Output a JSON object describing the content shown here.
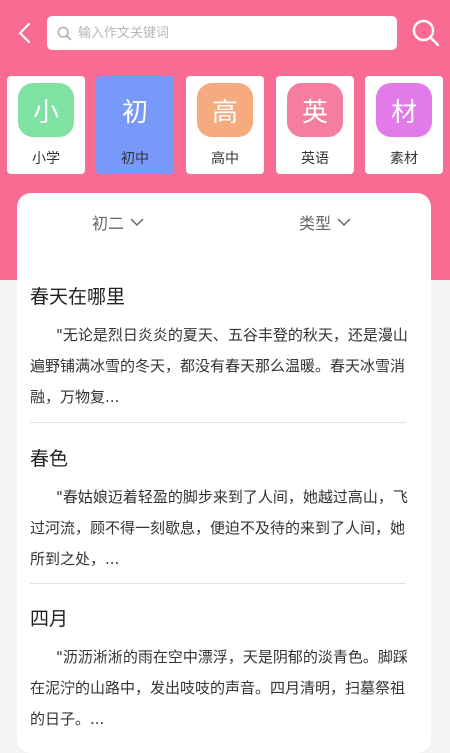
{
  "header": {
    "search_placeholder": "输入作文关键词"
  },
  "categories": [
    {
      "icon_char": "小",
      "label": "小学",
      "color": "#7fe2a3",
      "active": false
    },
    {
      "icon_char": "初",
      "label": "初中",
      "color": "#7899f9",
      "active": true
    },
    {
      "icon_char": "高",
      "label": "高中",
      "color": "#f6ab7e",
      "active": false
    },
    {
      "icon_char": "英",
      "label": "英语",
      "color": "#f57d9f",
      "active": false
    },
    {
      "icon_char": "材",
      "label": "素材",
      "color": "#e27ae9",
      "active": false
    }
  ],
  "filters": {
    "grade": "初二",
    "type": "类型"
  },
  "articles": [
    {
      "title": "春天在哪里",
      "excerpt": "\"无论是烈日炎炎的夏天、五谷丰登的秋天，还是漫山遍野铺满冰雪的冬天，都没有春天那么温暖。春天冰雪消融，万物复..."
    },
    {
      "title": "春色",
      "excerpt": "\"春姑娘迈着轻盈的脚步来到了人间，她越过高山，飞过河流，顾不得一刻歇息，便迫不及待的来到了人间，她所到之处，..."
    },
    {
      "title": "四月",
      "excerpt": "\"沥沥淅淅的雨在空中漂浮，天是阴郁的淡青色。脚踩在泥泞的山路中，发出吱吱的声音。四月清明，扫墓祭祖的日子。..."
    }
  ],
  "colors": {
    "header_bg": "#f86c94",
    "active_card": "#7899f9"
  },
  "icons": [
    "back-arrow-icon",
    "search-icon",
    "chevron-down-icon"
  ]
}
